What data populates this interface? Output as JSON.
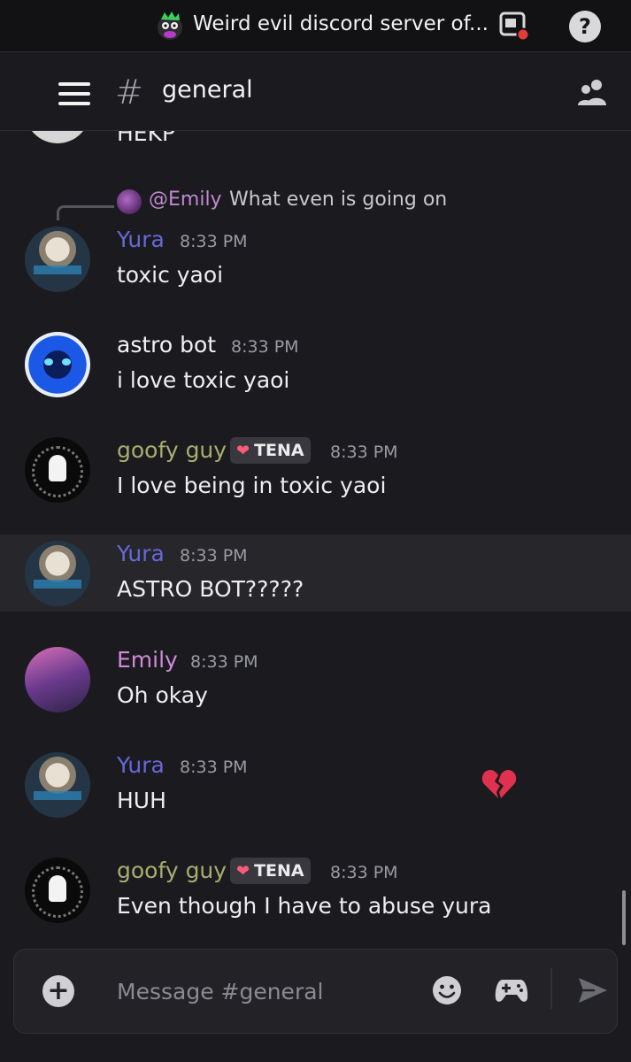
{
  "header": {
    "server_name": "Weird evil discord server of...",
    "channel_hash": "#",
    "channel_name": "general"
  },
  "help_glyph": "?",
  "partial_message": {
    "text": "HEKP"
  },
  "reply": {
    "mention": "@Emily",
    "text": "What even is going on"
  },
  "messages": [
    {
      "author": "Yura",
      "author_color": "#6668d8",
      "time": "8:33 PM",
      "text": "toxic yaoi"
    },
    {
      "author": "astro bot",
      "author_color": "#f2f2f3",
      "time": "8:33 PM",
      "text": "i love toxic yaoi"
    },
    {
      "author": "goofy guy",
      "author_color": "#a8ae6e",
      "tag": "TENA",
      "time": "8:33 PM",
      "text": "I love being in toxic yaoi"
    },
    {
      "author": "Yura",
      "author_color": "#6668d8",
      "time": "8:33 PM",
      "text": "ASTRO BOT?????"
    },
    {
      "author": "Emily",
      "author_color": "#cf8ad8",
      "time": "8:33 PM",
      "text": "Oh okay"
    },
    {
      "author": "Yura",
      "author_color": "#6668d8",
      "time": "8:33 PM",
      "text": "HUH"
    },
    {
      "author": "goofy guy",
      "author_color": "#a8ae6e",
      "tag": "TENA",
      "time": "8:33 PM",
      "text": "Even though I have to abuse yura",
      "emoji": "broken-heart"
    }
  ],
  "composer": {
    "placeholder": "Message #general",
    "plus_glyph": "+"
  },
  "icons": {
    "server": "server-avatar-icon",
    "screen_share": "screen-share-icon",
    "help": "help-icon",
    "menu": "hamburger-menu-icon",
    "members": "members-icon",
    "add": "plus-icon",
    "emoji": "emoji-icon",
    "activities": "gamepad-icon",
    "send": "send-icon"
  },
  "colors": {
    "background": "#1b1b1f",
    "topbar": "#121214",
    "mention": "#c287d4",
    "notification_dot": "#e53b3b"
  }
}
